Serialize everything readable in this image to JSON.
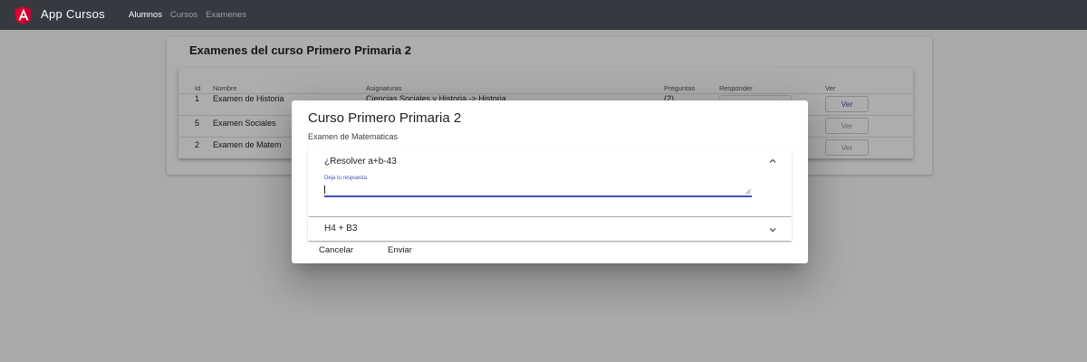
{
  "navbar": {
    "brand": "App Cursos",
    "links": [
      "Alumnos",
      "Cursos",
      "Examenes"
    ],
    "accent": "#dd0031"
  },
  "page": {
    "title": "Examenes del curso Primero Primaria 2",
    "table": {
      "headers": [
        "Id",
        "Nombre",
        "Asignaturas",
        "Preguntas",
        "Responder",
        "Ver"
      ],
      "rows": [
        {
          "id": "1",
          "nombre": "Examen de Historia",
          "asignaturas": "Ciencias Sociales y Historia -> Historia",
          "preguntas": "(2)",
          "ver": "Ver"
        },
        {
          "id": "5",
          "nombre": "Examen Sociales",
          "ver": "Ver"
        },
        {
          "id": "2",
          "nombre": "Examen de Matem",
          "ver": "Ver"
        }
      ]
    }
  },
  "dialog": {
    "title": "Curso Primero Primaria 2",
    "subtitle": "Examen de Matematicas",
    "questions": [
      {
        "title": "¿Resolver a+b-43",
        "expanded": true,
        "field_label": "Deja tu respuesta",
        "value": ""
      },
      {
        "title": "H4 + B3",
        "expanded": false
      }
    ],
    "actions": {
      "cancel": "Cancelar",
      "submit": "Enviar"
    }
  }
}
